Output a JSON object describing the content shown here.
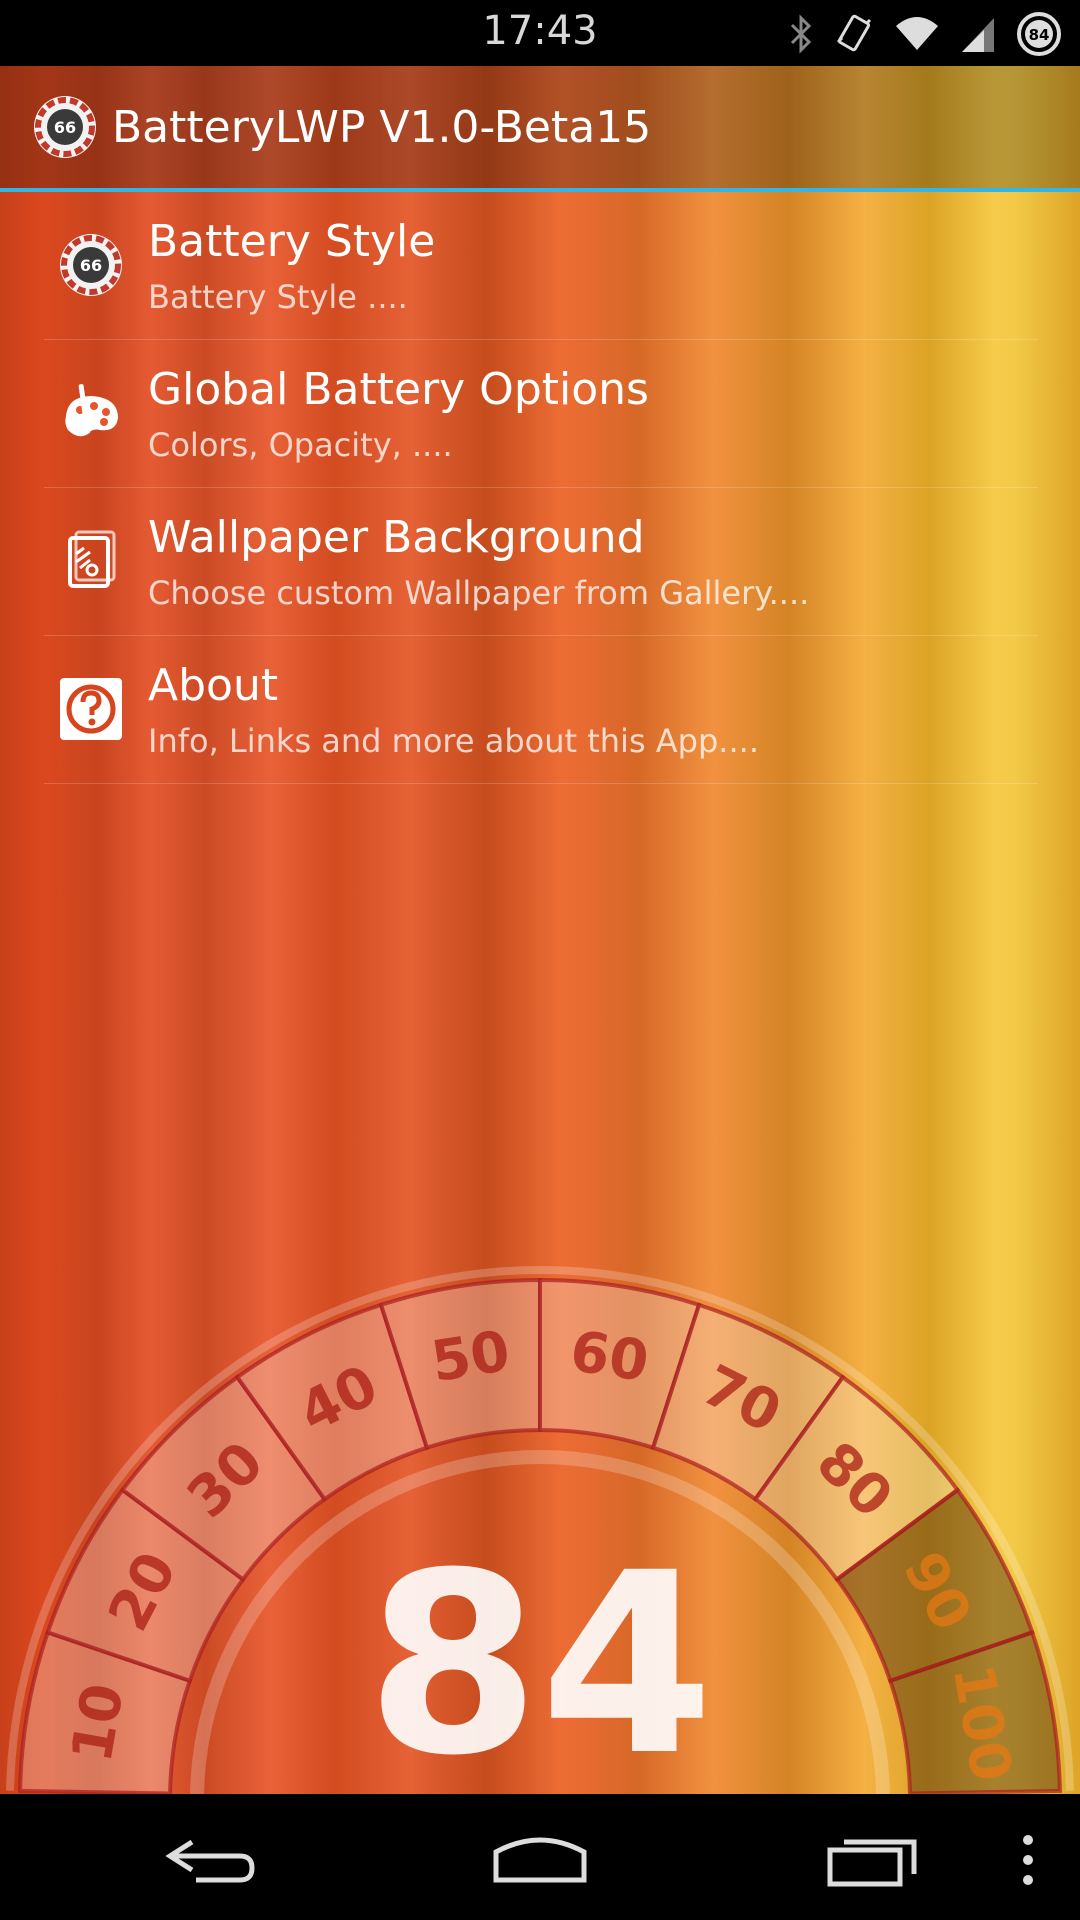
{
  "status_bar": {
    "time": "17:43",
    "battery_level": "84",
    "icons": [
      "bluetooth-icon",
      "vibrate-icon",
      "wifi-icon",
      "signal-icon",
      "battery-icon"
    ]
  },
  "app_bar": {
    "title": "BatteryLWP V1.0-Beta15",
    "icon_badge": "66"
  },
  "menu": {
    "items": [
      {
        "title": "Battery Style",
        "subtitle": "Battery Style ....",
        "icon": "battery-style-icon",
        "badge": "66"
      },
      {
        "title": "Global Battery Options",
        "subtitle": "Colors, Opacity, ....",
        "icon": "palette-icon"
      },
      {
        "title": "Wallpaper Background",
        "subtitle": "Choose custom Wallpaper from Gallery....",
        "icon": "wallpaper-icon"
      },
      {
        "title": "About",
        "subtitle": "Info, Links and more about this App....",
        "icon": "help-icon"
      }
    ]
  },
  "gauge": {
    "ticks": [
      "10",
      "20",
      "30",
      "40",
      "50",
      "60",
      "70",
      "80",
      "90",
      "100"
    ],
    "level": 84,
    "value_label": "84"
  },
  "nav_bar": {
    "buttons": [
      "back-icon",
      "home-icon",
      "recents-icon",
      "overflow-icon"
    ]
  },
  "colors": {
    "accent": "#33b5e5",
    "status_background": "#000000"
  }
}
